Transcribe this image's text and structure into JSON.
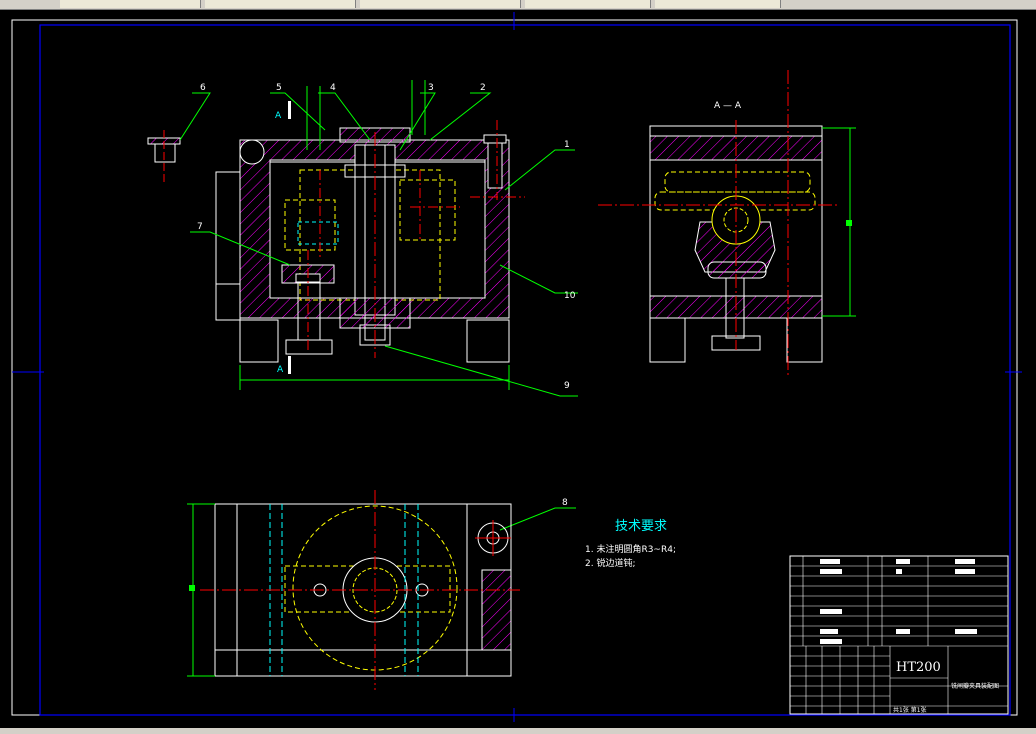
{
  "app": {
    "tabs": [
      "",
      "",
      "",
      "",
      ""
    ]
  },
  "drawing": {
    "section_label": "A — A",
    "section_marker": "A",
    "parts": [
      "1",
      "2",
      "3",
      "4",
      "5",
      "6",
      "7",
      "8",
      "9",
      "10"
    ],
    "tech_title": "技术要求",
    "tech_items": [
      "1. 未注明圆角R3~R4;",
      "2. 锐边道钝;"
    ],
    "title_block": {
      "material": "HT200",
      "drawing_name": "铣闸瓣夹具装配图",
      "sheet_info": "共1张 第1张"
    }
  },
  "colors": {
    "outline": "#ffffff",
    "hidden": "#ffff00",
    "hatch": "#ff00ff",
    "center": "#ff0000",
    "leader": "#00ff00",
    "frame": "#0000ff",
    "dim": "#00ffff"
  }
}
